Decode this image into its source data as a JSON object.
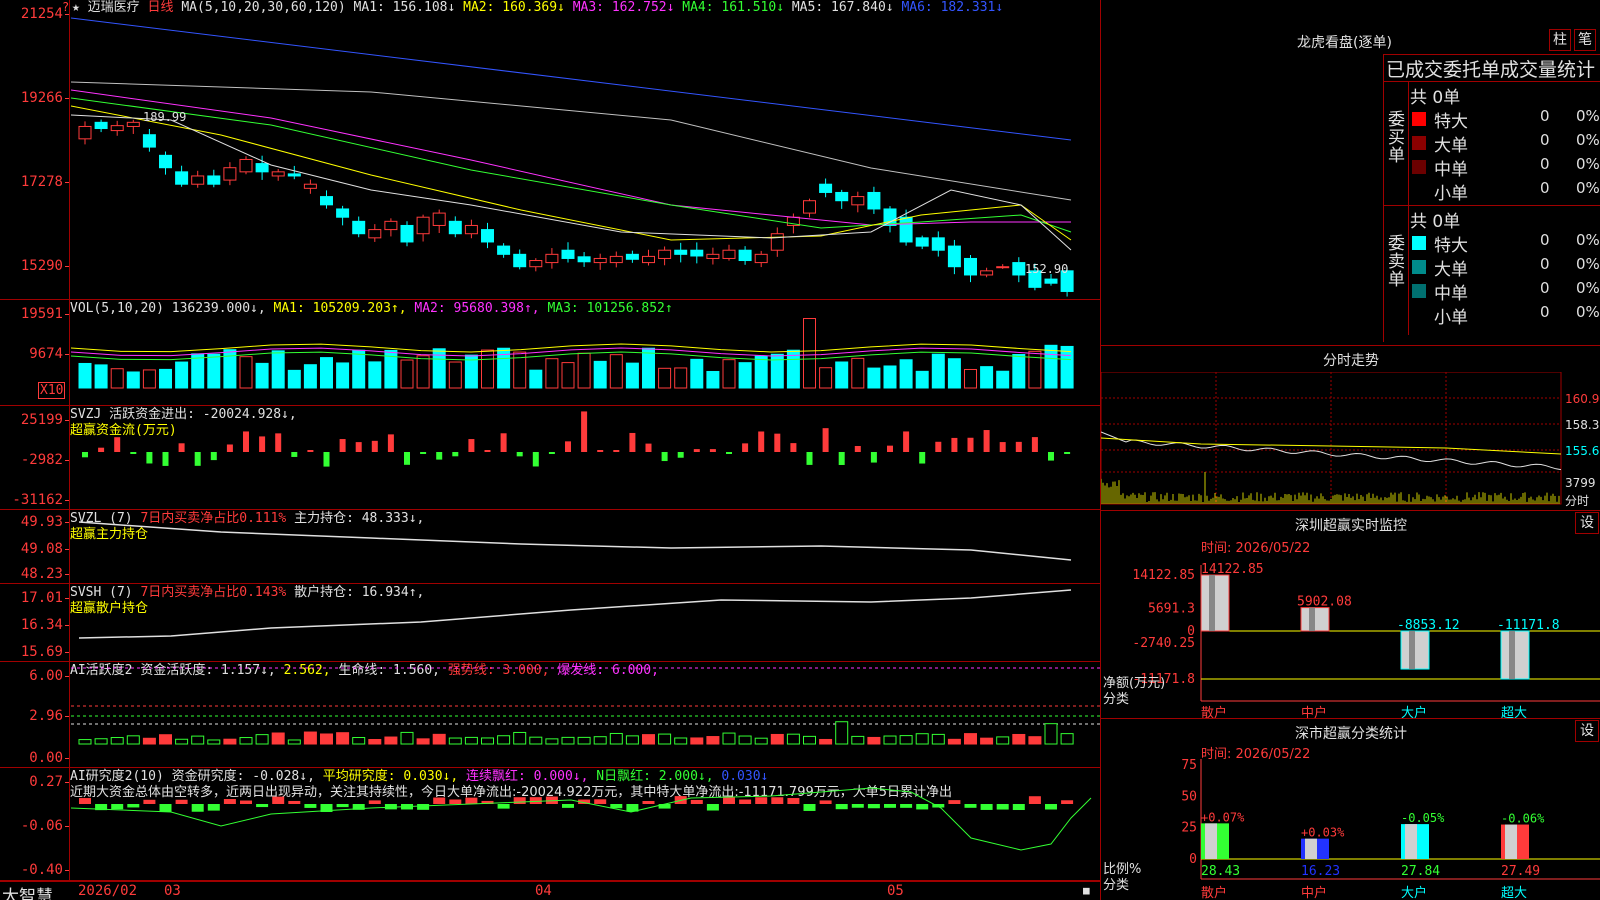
{
  "colors": {
    "up": "#ff3b3b",
    "down": "#00ffff",
    "grid": "#a00000",
    "ma1": "#e0e0e0",
    "ma2": "#ffff00",
    "ma3": "#ff33ff",
    "ma4": "#33ff33",
    "ma5": "#c0c0c0",
    "ma6": "#3355ff"
  },
  "main": {
    "star": "★",
    "flag": "?",
    "stock_name": "迈瑞医疗",
    "period": "日线",
    "ma_params": "MA(5,10,20,30,60,120)",
    "ma1": "MA1: 156.108↓",
    "ma2": "MA2: 160.369↓",
    "ma3": "MA3: 162.752↓",
    "ma4": "MA4: 161.510↓",
    "ma5": "MA5: 167.840↓",
    "ma6": "MA6: 182.331↓",
    "high_label": "189.99",
    "low_label": "152.90",
    "ticks": [
      "21254",
      "19266",
      "17278",
      "15290"
    ]
  },
  "vol": {
    "header": "VOL(5,10,20)",
    "value": "136239.000↓,",
    "ma1": "MA1: 105209.203↑,",
    "ma2": "MA2: 95680.398↑,",
    "ma3": "MA3: 101256.852↑",
    "ticks": [
      "19591",
      "9674"
    ],
    "unit": "X10"
  },
  "svzj": {
    "line1_name": "SVZJ",
    "line1_label": "活跃资金进出: -20024.928↓,",
    "line2": "超赢资金流(万元)",
    "ticks": [
      "25199",
      "-2982",
      "-31162"
    ]
  },
  "svzl": {
    "name": "SVZL (7)",
    "ratio": "7日内买卖净占比0.111%",
    "hold": "主力持仓: 48.333↓,",
    "line2": "超赢主力持仓",
    "ticks": [
      "49.93",
      "49.08",
      "48.23"
    ]
  },
  "svsh": {
    "name": "SVSH (7)",
    "ratio": "7日内买卖净占比0.143%",
    "hold": "散户持仓: 16.934↑,",
    "line2": "超赢散户持仓",
    "ticks": [
      "17.01",
      "16.34",
      "15.69"
    ]
  },
  "ai1": {
    "name": "AI活跃度2",
    "a": "资金活跃度: 1.157↓,",
    "b": "2.562,",
    "c": "生命线: 1.560,",
    "d": "强势线: 3.000,",
    "e": "爆发线: 6.000,",
    "ticks": [
      "6.00",
      "2.96",
      "0.00"
    ]
  },
  "ai2": {
    "name": "AI研究度2(10)",
    "a": "资金研究度: -0.028↓,",
    "b": "平均研究度: 0.030↓,",
    "c": "连续飘红: 0.000↓,",
    "d": "N日飘红: 2.000↓,",
    "e": "0.030↓",
    "comment": "近期大资金总体由空转多，近两日出现异动，关注其持续性，今日大单净流出:-20024.922万元，其中特大单净流出:-11171.799万元，大单5日累计净出",
    "ticks": [
      "0.27",
      "-0.06",
      "-0.40"
    ]
  },
  "xaxis": {
    "brand": "大智慧",
    "labels": [
      "2026/02",
      "03",
      "04",
      "05"
    ]
  },
  "dragon": {
    "title": "龙虎看盘(逐单)",
    "btn1": "柱",
    "btn2": "笔",
    "subtitle": "已成交委托单成交量统计",
    "buy_side": "委买单",
    "sell_side": "委卖单",
    "buy_total": "共 0单",
    "sell_total": "共 0单",
    "buy_rows": [
      {
        "label": "特大",
        "count": "0",
        "pct": "0%",
        "color": "#ff0000"
      },
      {
        "label": "大单",
        "count": "0",
        "pct": "0%",
        "color": "#8b0000"
      },
      {
        "label": "中单",
        "count": "0",
        "pct": "0%",
        "color": "#6b0000"
      },
      {
        "label": "小单",
        "count": "0",
        "pct": "0%",
        "color": ""
      }
    ],
    "sell_rows": [
      {
        "label": "特大",
        "count": "0",
        "pct": "0%",
        "color": "#00ffff"
      },
      {
        "label": "大单",
        "count": "0",
        "pct": "0%",
        "color": "#008b8b"
      },
      {
        "label": "中单",
        "count": "0",
        "pct": "0%",
        "color": "#007070"
      },
      {
        "label": "小单",
        "count": "0",
        "pct": "0%",
        "color": ""
      }
    ]
  },
  "intraday": {
    "title": "分时走势",
    "ticks": [
      "160.9",
      "158.3",
      "155.6"
    ],
    "vol_label": "3799",
    "unit": "分时"
  },
  "monitor": {
    "title": "深圳超赢实时监控",
    "btn": "设",
    "date": "时间: 2026/05/22",
    "ticks": [
      "14122.85",
      "5691.3",
      "0",
      "-2740.25",
      "-11171.8"
    ],
    "ylabel1": "净额(万元)",
    "ylabel2": "分类"
  },
  "classify": {
    "title": "深市超赢分类统计",
    "btn": "设",
    "date": "时间: 2026/05/22",
    "ticks": [
      "75",
      "50",
      "25",
      "0"
    ],
    "ylabel1": "比例%",
    "ylabel2": "分类"
  },
  "chart_data": [
    {
      "type": "bar",
      "title": "深圳超赢实时监控",
      "categories": [
        "散户",
        "中户",
        "大户",
        "超大"
      ],
      "values": [
        14122.85,
        5902.08,
        -8853.12,
        -11171.8
      ],
      "ylabel": "净额(万元)",
      "ylim": [
        -11171.8,
        14122.85
      ]
    },
    {
      "type": "bar",
      "title": "深市超赢分类统计",
      "categories": [
        "散户",
        "中户",
        "大户",
        "超大"
      ],
      "values": [
        28.43,
        16.23,
        27.84,
        27.49
      ],
      "changes": [
        "+0.07%",
        "+0.03%",
        "-0.05%",
        "-0.06%"
      ],
      "ylabel": "比例%",
      "ylim": [
        0,
        75
      ]
    }
  ]
}
